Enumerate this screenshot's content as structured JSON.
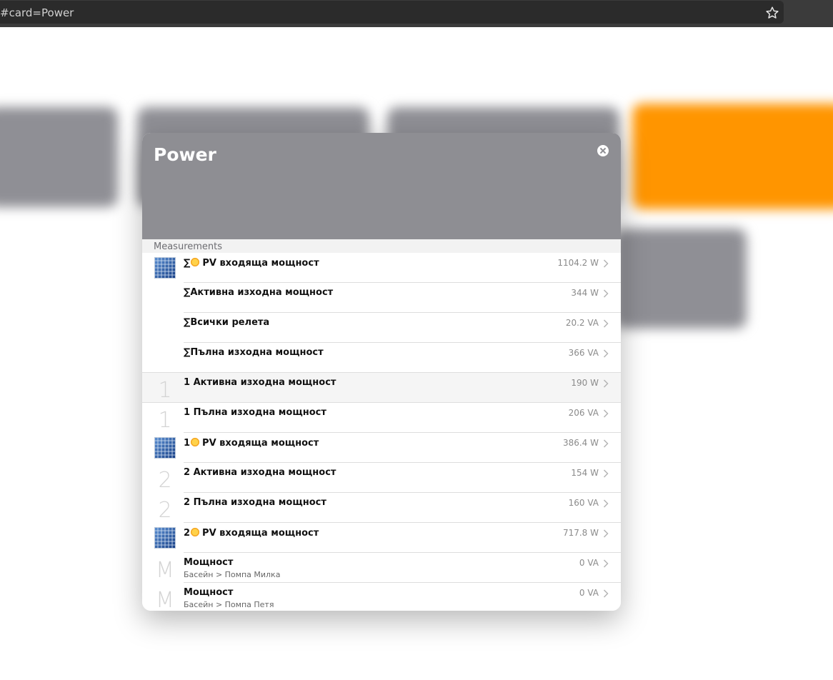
{
  "browser": {
    "url": "#card=Power",
    "bookmark_icon": "star-icon"
  },
  "modal": {
    "title": "Power",
    "close_icon": "close-icon",
    "section_header": "Measurements",
    "rows": [
      {
        "icon": "solar-panel-icon",
        "label_prefix": "∑",
        "has_sun": true,
        "label": "PV входяща мощност",
        "value": "1104.2 W"
      },
      {
        "icon": "none",
        "label": "∑Активна изходна мощност",
        "value": "344 W"
      },
      {
        "icon": "none",
        "label": "∑Всички релета",
        "value": "20.2 VA"
      },
      {
        "icon": "none",
        "label": "∑Пълна изходна мощност",
        "value": "366 VA"
      },
      {
        "icon": "glyph",
        "glyph": "1",
        "label": "1 Активна изходна мощност",
        "value": "190 W",
        "highlighted": true
      },
      {
        "icon": "glyph",
        "glyph": "1",
        "label": "1 Пълна изходна мощност",
        "value": "206 VA"
      },
      {
        "icon": "solar-panel-icon",
        "label_prefix": "1",
        "has_sun": true,
        "label": "PV входяща мощност",
        "value": "386.4 W"
      },
      {
        "icon": "glyph",
        "glyph": "2",
        "label": "2 Активна изходна мощност",
        "value": "154 W"
      },
      {
        "icon": "glyph",
        "glyph": "2",
        "label": "2 Пълна изходна мощност",
        "value": "160 VA"
      },
      {
        "icon": "solar-panel-icon",
        "label_prefix": "2",
        "has_sun": true,
        "label": "PV входяща мощност",
        "value": "717.8 W"
      },
      {
        "icon": "glyph",
        "glyph": "M",
        "label": "Мощност",
        "subtitle": "Басейн > Помпа Милка",
        "value": "0 VA"
      },
      {
        "icon": "glyph",
        "glyph": "M",
        "label": "Мощност",
        "subtitle": "Басейн > Помпа Петя",
        "value": "0 VA"
      }
    ]
  },
  "colors": {
    "header": "#8e8e93",
    "accent_tile": "#ff9500"
  }
}
